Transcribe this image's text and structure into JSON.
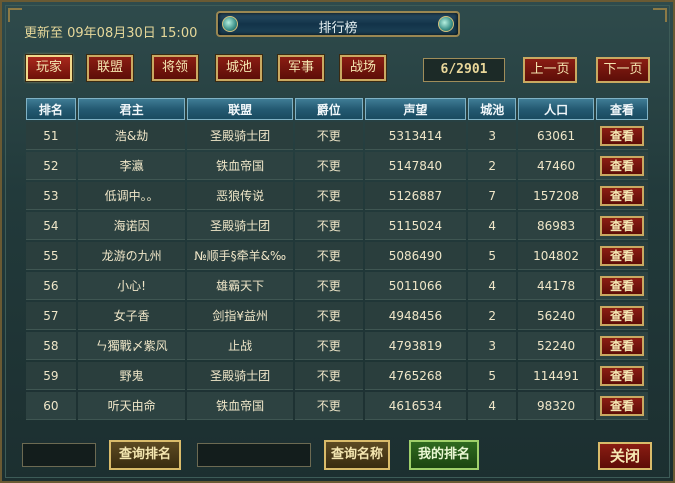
{
  "header": {
    "update_text": "更新至 09年08月30日 15:00",
    "title": "排行榜"
  },
  "tabs": [
    {
      "label": "玩家",
      "active": true
    },
    {
      "label": "联盟",
      "active": false
    },
    {
      "label": "将领",
      "active": false
    },
    {
      "label": "城池",
      "active": false
    },
    {
      "label": "军事",
      "active": false
    },
    {
      "label": "战场",
      "active": false
    }
  ],
  "pagination": {
    "page_text": "6/2901",
    "prev_label": "上一页",
    "next_label": "下一页"
  },
  "table": {
    "columns": [
      "排名",
      "君主",
      "联盟",
      "爵位",
      "声望",
      "城池",
      "人口",
      "查看"
    ],
    "view_label": "查看",
    "rows": [
      [
        "51",
        "浩&劫",
        "圣殿骑士团",
        "不更",
        "5313414",
        "3",
        "63061"
      ],
      [
        "52",
        "李瀛",
        "铁血帝国",
        "不更",
        "5147840",
        "2",
        "47460"
      ],
      [
        "53",
        "低调中。。",
        "恶狼传说",
        "不更",
        "5126887",
        "7",
        "157208"
      ],
      [
        "54",
        "海诺因",
        "圣殿骑士团",
        "不更",
        "5115024",
        "4",
        "86983"
      ],
      [
        "55",
        "龙游の九州",
        "№顺手§牵羊&‰",
        "不更",
        "5086490",
        "5",
        "104802"
      ],
      [
        "56",
        "小心!",
        "雄霸天下",
        "不更",
        "5011066",
        "4",
        "44178"
      ],
      [
        "57",
        "女子香",
        "剑指¥益州",
        "不更",
        "4948456",
        "2",
        "56240"
      ],
      [
        "58",
        "ㄣ獨戰〆紫风",
        "止战",
        "不更",
        "4793819",
        "3",
        "52240"
      ],
      [
        "59",
        "野鬼",
        "圣殿骑士团",
        "不更",
        "4765268",
        "5",
        "114491"
      ],
      [
        "60",
        "听天由命",
        "铁血帝国",
        "不更",
        "4616534",
        "4",
        "98320"
      ]
    ]
  },
  "footer": {
    "rank_input_value": "",
    "query_rank_label": "查询排名",
    "name_input_value": "",
    "query_name_label": "查询名称",
    "my_rank_label": "我的排名",
    "close_label": "关闭"
  }
}
